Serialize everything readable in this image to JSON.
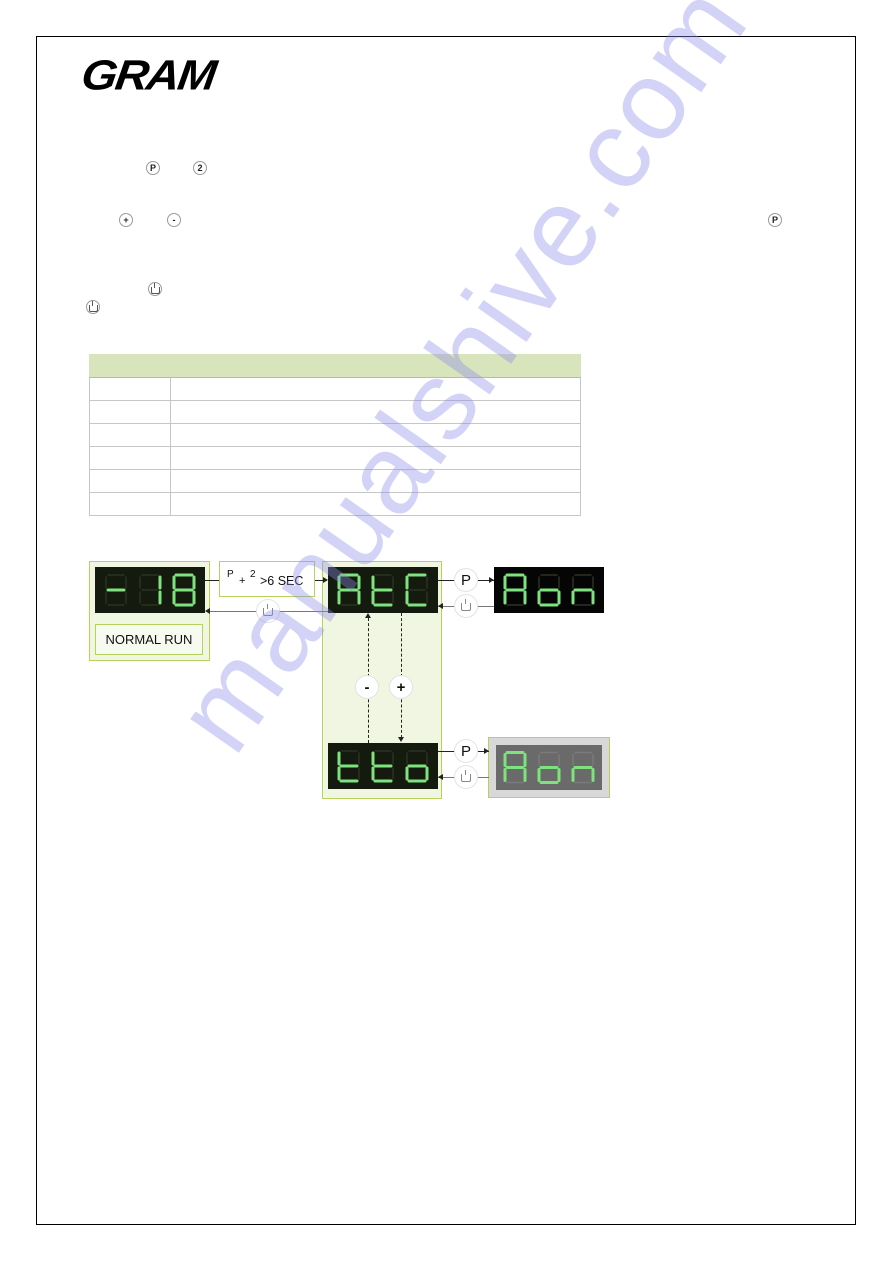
{
  "page": {
    "brand_logo_text": "GRAM",
    "watermark": "manualshive.com"
  },
  "inline_buttons": {
    "row1": [
      "P",
      "2"
    ],
    "row2": [
      "+",
      "-"
    ],
    "row2_right": "P",
    "row3": [
      "power"
    ],
    "row4": [
      "power"
    ]
  },
  "table": {
    "header": [
      "",
      ""
    ],
    "rows": [
      [
        "",
        ""
      ],
      [
        "",
        ""
      ],
      [
        "",
        ""
      ],
      [
        "",
        ""
      ],
      [
        "",
        ""
      ],
      [
        "",
        ""
      ]
    ]
  },
  "diagram": {
    "normal_run": {
      "display": "-18",
      "label": "NORMAL RUN"
    },
    "combo_button": {
      "key1": "P",
      "plus": "+",
      "key2": "2",
      "duration": ">6 SEC"
    },
    "menu": {
      "atc_display": "AtC",
      "tto_display": "tto",
      "minus_label": "-",
      "plus_label": "+"
    },
    "atc_value": {
      "display": "Aon",
      "state": "active"
    },
    "tto_value": {
      "display": "Aon",
      "state": "dimmed"
    },
    "p_key_label": "P",
    "power_key_icon": "power-icon",
    "segment_on_color": "#7ee27e",
    "segment_off_color": "#2b3324",
    "panel_border_color": "#b5d25a",
    "table_header_color": "#d8e4bc"
  }
}
